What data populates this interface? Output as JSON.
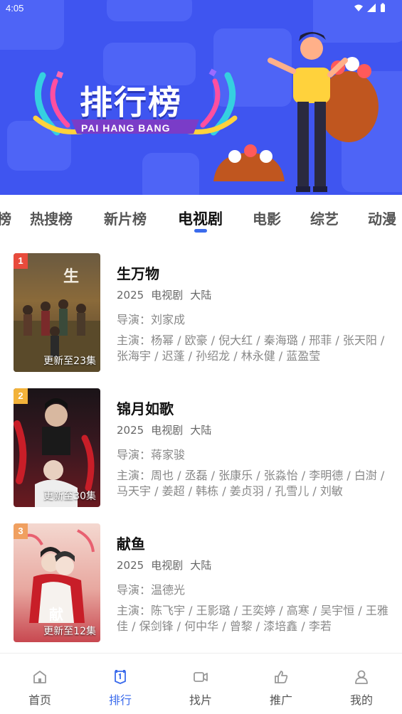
{
  "status": {
    "time": "4:05"
  },
  "banner": {
    "title": "排行榜",
    "subtitle": "PAI HANG BANG"
  },
  "tabs": [
    {
      "label": "榜",
      "active": false
    },
    {
      "label": "热搜榜",
      "active": false
    },
    {
      "label": "新片榜",
      "active": false
    },
    {
      "label": "电视剧",
      "active": true
    },
    {
      "label": "电影",
      "active": false
    },
    {
      "label": "综艺",
      "active": false
    },
    {
      "label": "动漫",
      "active": false
    }
  ],
  "items": [
    {
      "rank": "1",
      "rank_color": "#e84b3c",
      "title": "生万物",
      "year": "2025",
      "type": "电视剧",
      "region": "大陆",
      "director": "导演：刘家成",
      "cast": "主演：杨幂 / 欧豪 / 倪大红 / 秦海璐 / 邢菲 / 张天阳 / 张海宇 / 迟蓬 / 孙绍龙 / 林永健 / 蓝盈莹",
      "update": "更新至23集"
    },
    {
      "rank": "2",
      "rank_color": "#f2b23a",
      "title": "锦月如歌",
      "year": "2025",
      "type": "电视剧",
      "region": "大陆",
      "director": "导演：蒋家骏",
      "cast": "主演：周也 / 丞磊 / 张康乐 / 张淼怡 / 李明德 / 白澍 / 马天宇 / 姜超 / 韩栋 / 姜贞羽 / 孔雪儿 / 刘敏",
      "update": "更新至30集"
    },
    {
      "rank": "3",
      "rank_color": "#f0a060",
      "title": "献鱼",
      "year": "2025",
      "type": "电视剧",
      "region": "大陆",
      "director": "导演：温德光",
      "cast": "主演：陈飞宇 / 王影璐 / 王奕婷 / 高寒 / 吴宇恒 / 王雅佳 / 保剑锋 / 何中华 / 曾黎 / 漆培鑫 / 李若",
      "update": "更新至12集"
    }
  ],
  "nav": [
    {
      "label": "首页",
      "icon": "home-icon",
      "active": false
    },
    {
      "label": "排行",
      "icon": "ranking-icon",
      "active": true
    },
    {
      "label": "找片",
      "icon": "video-camera-icon",
      "active": false
    },
    {
      "label": "推广",
      "icon": "thumbs-up-icon",
      "active": false
    },
    {
      "label": "我的",
      "icon": "user-icon",
      "active": false
    }
  ],
  "colors": {
    "accent": "#3b6bec",
    "banner_bg": "#3f55f0"
  }
}
